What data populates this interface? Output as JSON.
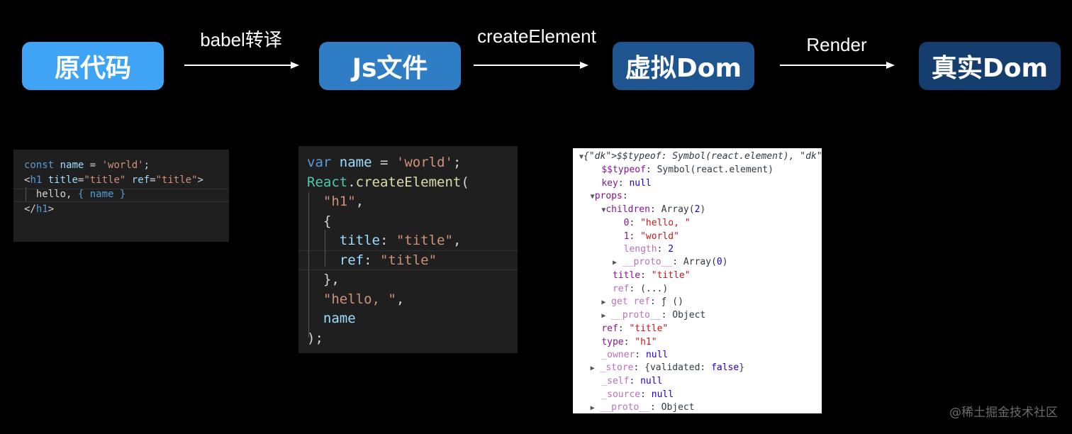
{
  "flow": {
    "nodes": [
      {
        "label": "原代码",
        "color": "#3fa4f5"
      },
      {
        "label": "Js文件",
        "color": "#2f7dc4"
      },
      {
        "label": "虚拟Dom",
        "color": "#1e5490"
      },
      {
        "label": "真实Dom",
        "color": "#153e6e"
      }
    ],
    "edges": [
      {
        "label": "babel转译"
      },
      {
        "label": "createElement"
      },
      {
        "label": "Render"
      }
    ]
  },
  "code_source": {
    "lines": [
      "const name = 'world';",
      "<h1 title=\"title\" ref=\"title\">",
      "  hello, { name }",
      "</h1>"
    ]
  },
  "code_compiled": {
    "lines": [
      "var name = 'world';",
      "React.createElement(",
      "  \"h1\",",
      "  {",
      "    title: \"title\",",
      "    ref: \"title\"",
      "  },",
      "  \"hello, \",",
      "  name",
      ");"
    ]
  },
  "virtual_dom": {
    "lines": [
      "{$$typeof: Symbol(react.element), type: \"h1\"",
      "$$typeof: Symbol(react.element)",
      "key: null",
      "props:",
      "children: Array(2)",
      "0: \"hello, \"",
      "1: \"world\"",
      "length: 2",
      "__proto__: Array(0)",
      "title: \"title\"",
      "ref: (...)",
      "get ref: ƒ ()",
      "__proto__: Object",
      "ref: \"title\"",
      "type: \"h1\"",
      "_owner: null",
      "_store: {validated: false}",
      "_self: null",
      "_source: null",
      "__proto__: Object"
    ]
  },
  "watermark": "@稀土掘金技术社区"
}
